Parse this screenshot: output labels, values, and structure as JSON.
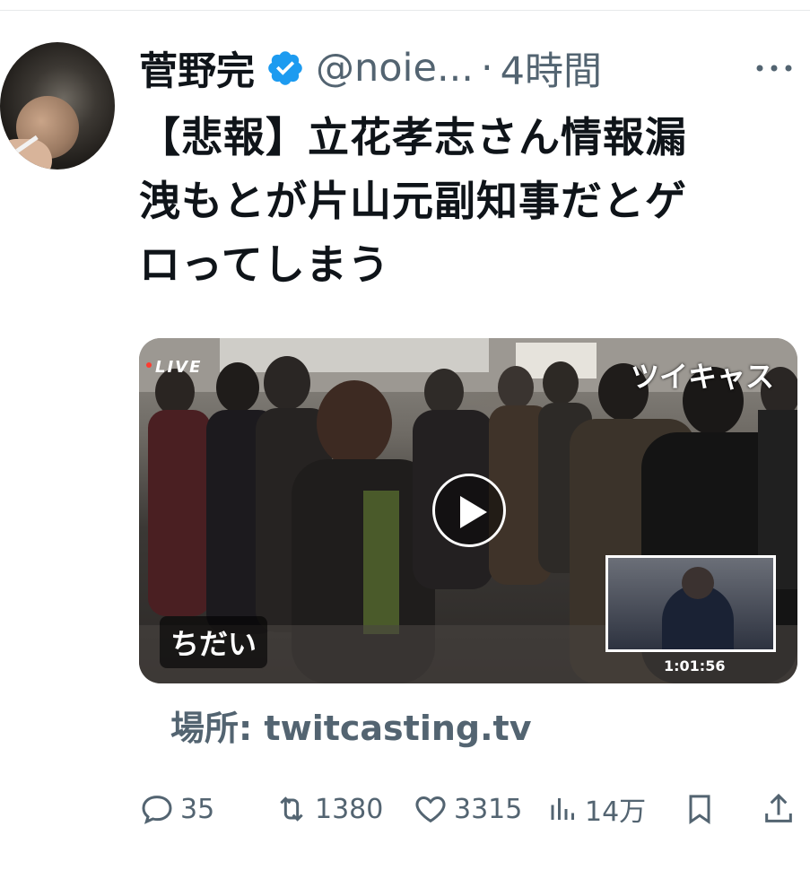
{
  "author": {
    "name": "菅野完",
    "handle": "@noie...",
    "separator": "·",
    "time": "4時間"
  },
  "tweet": {
    "text": "【悲報】立花孝志さん情報漏\n洩もとが片山元副知事だとゲ\nロってしまう"
  },
  "media": {
    "live_label": "LIVE",
    "watermark": "ツイキャス",
    "caster_label": "ちだい",
    "duration": "1:01:56"
  },
  "card": {
    "source": "場所: twitcasting.tv"
  },
  "actions": {
    "replies": "35",
    "retweets": "1380",
    "likes": "3315",
    "views": "14万"
  },
  "colors": {
    "verified": "#1d9bf0",
    "secondary_text": "#536471",
    "primary_text": "#0f1419"
  }
}
